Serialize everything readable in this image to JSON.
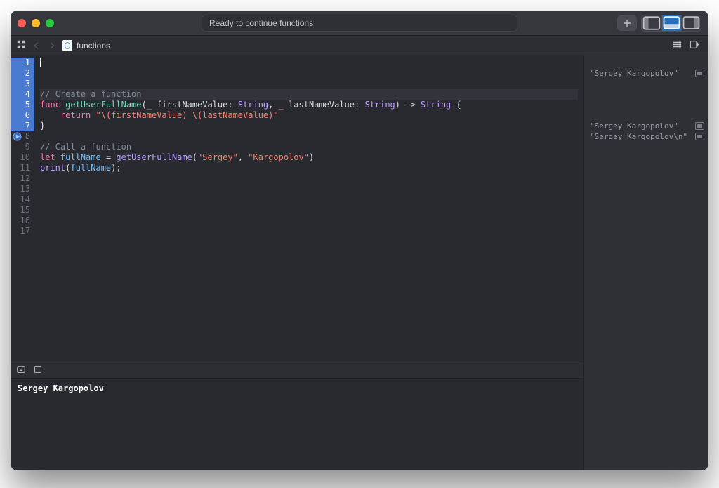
{
  "window": {
    "status": "Ready to continue functions"
  },
  "path": {
    "file_name": "functions"
  },
  "code": {
    "lines": [
      {
        "n": 1,
        "type": "cmt",
        "text": "// Create a function"
      },
      {
        "n": 2,
        "type": "sig",
        "kw1": "func",
        "fn": " getUserFullName",
        "p1": "(",
        "u1": "_",
        "a1": " firstNameValue: ",
        "t1": "String",
        "comma": ", ",
        "u2": "_",
        "a2": " lastNameValue: ",
        "t2": "String",
        "p2": ") -> ",
        "ret": "String",
        "brace": " {"
      },
      {
        "n": 3,
        "type": "ret",
        "pad": "    ",
        "kw": "return",
        "sp": " ",
        "str": "\"\\(firstNameValue) \\(lastNameValue)\""
      },
      {
        "n": 4,
        "type": "close",
        "text": "}"
      },
      {
        "n": 5,
        "type": "blank",
        "text": ""
      },
      {
        "n": 6,
        "type": "cmt",
        "text": "// Call a function"
      },
      {
        "n": 7,
        "type": "let",
        "kw": "let",
        "sp": " ",
        "var": "fullName",
        "eq": " = ",
        "fn": "getUserFullName",
        "open": "(",
        "s1": "\"Sergey\"",
        "comma": ", ",
        "s2": "\"Kargopolov\"",
        "close": ")"
      },
      {
        "n": 8,
        "type": "print",
        "fn": "print",
        "open": "(",
        "var": "fullName",
        "close": ");"
      },
      {
        "n": 9,
        "type": "blank",
        "text": ""
      },
      {
        "n": 10,
        "type": "blank",
        "text": ""
      },
      {
        "n": 11,
        "type": "blank",
        "text": ""
      },
      {
        "n": 12,
        "type": "blank",
        "text": ""
      },
      {
        "n": 13,
        "type": "blank",
        "text": ""
      },
      {
        "n": 14,
        "type": "blank",
        "text": ""
      },
      {
        "n": 15,
        "type": "blank",
        "text": ""
      },
      {
        "n": 16,
        "type": "blank",
        "text": ""
      },
      {
        "n": 17,
        "type": "blank",
        "text": ""
      }
    ],
    "highlighted_lines": [
      1,
      2,
      3,
      4,
      5,
      6,
      7
    ],
    "run_marker_line": 8
  },
  "results": {
    "rows": [
      {
        "line": 2,
        "text": "\"Sergey Kargopolov\""
      },
      {
        "line": 7,
        "text": "\"Sergey Kargopolov\""
      },
      {
        "line": 8,
        "text": "\"Sergey Kargopolov\\n\""
      }
    ]
  },
  "console": {
    "output": "Sergey Kargopolov"
  }
}
